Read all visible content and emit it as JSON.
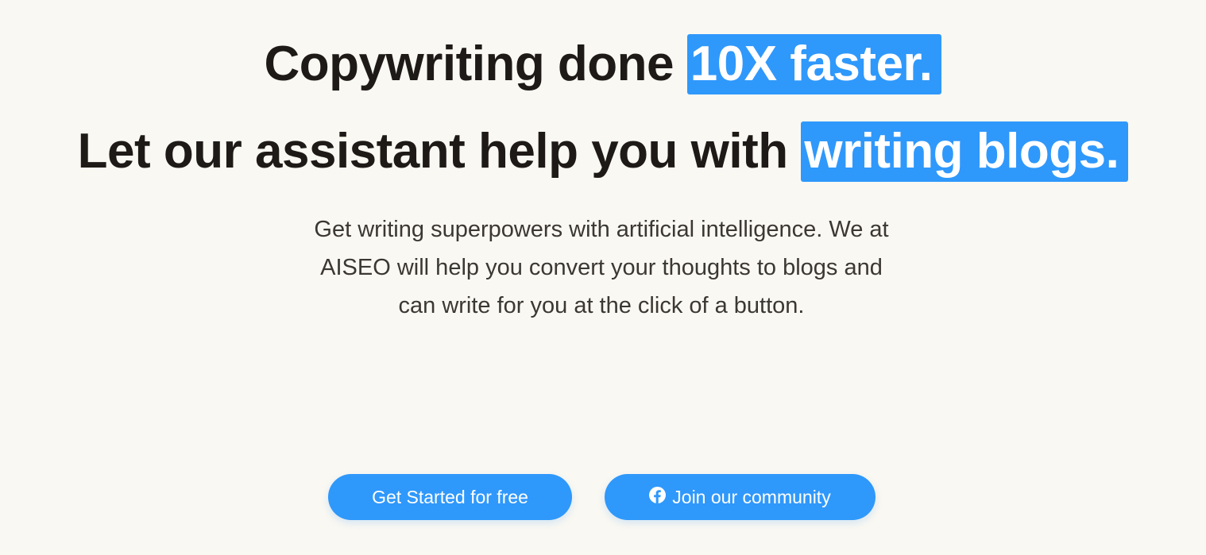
{
  "hero": {
    "line1_text": "Copywriting done ",
    "line1_highlight": "10X faster.",
    "line2_text": "Let our assistant help you with ",
    "line2_highlight": "writing blogs.",
    "description": "Get writing superpowers with artificial intelligence. We at AISEO will help you convert your thoughts to blogs and can write for you at the click of a button."
  },
  "buttons": {
    "primary_label": "Get Started for free",
    "secondary_label": "Join our community",
    "secondary_icon": "facebook-icon"
  },
  "colors": {
    "background": "#faf8f2",
    "accent": "#2f98fb",
    "text": "#1e1a17"
  }
}
